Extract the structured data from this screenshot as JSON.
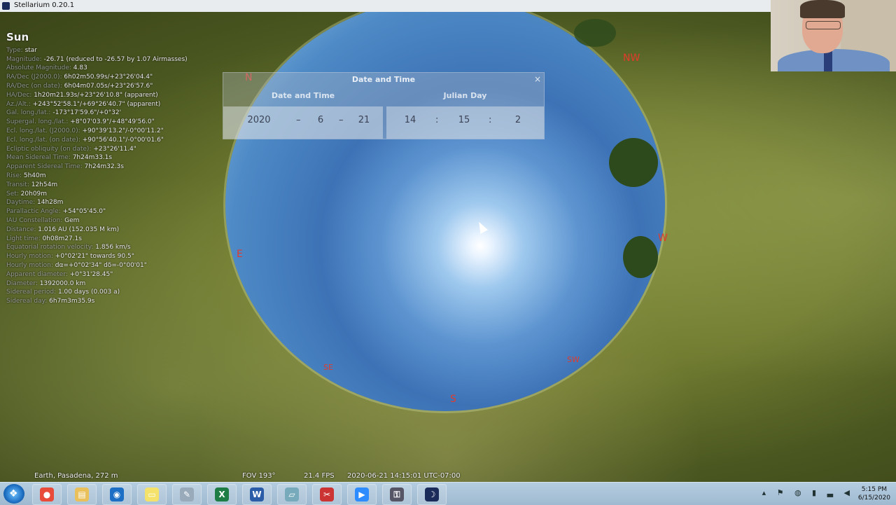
{
  "window": {
    "title": "Stellarium 0.20.1"
  },
  "object_info": {
    "name": "Sun",
    "lines": [
      {
        "label": "Type: ",
        "value": "star"
      },
      {
        "label": "Magnitude: ",
        "value": "-26.71 (reduced to -26.57 by 1.07 Airmasses)"
      },
      {
        "label": "Absolute Magnitude: ",
        "value": "4.83"
      },
      {
        "label": "RA/Dec (J2000.0): ",
        "value": "6h02m50.99s/+23°26'04.4\""
      },
      {
        "label": "RA/Dec (on date): ",
        "value": "6h04m07.05s/+23°26'57.6\""
      },
      {
        "label": "HA/Dec: ",
        "value": "1h20m21.93s/+23°26'10.8\" (apparent)"
      },
      {
        "label": "Az./Alt.: ",
        "value": "+243°52'58.1\"/+69°26'40.7\" (apparent)"
      },
      {
        "label": "Gal. long./lat.: ",
        "value": "-173°17'59.6\"/+0°32'"
      },
      {
        "label": "Supergal. long./lat.: ",
        "value": "+8°07'03.9\"/+48°49'56.0\""
      },
      {
        "label": "Ecl. long./lat. (J2000.0): ",
        "value": "+90°39'13.2\"/-0°00'11.2\""
      },
      {
        "label": "Ecl. long./lat. (on date): ",
        "value": "+90°56'40.1\"/-0°00'01.6\""
      },
      {
        "label": "Ecliptic obliquity (on date): ",
        "value": "+23°26'11.4\""
      },
      {
        "label": "Mean Sidereal Time: ",
        "value": "7h24m33.1s"
      },
      {
        "label": "Apparent Sidereal Time: ",
        "value": "7h24m32.3s"
      },
      {
        "label": "Rise: ",
        "value": "5h40m"
      },
      {
        "label": "Transit: ",
        "value": "12h54m"
      },
      {
        "label": "Set: ",
        "value": "20h09m"
      },
      {
        "label": "Daytime: ",
        "value": "14h28m"
      },
      {
        "label": "Parallactic Angle: ",
        "value": "+54°05'45.0\""
      },
      {
        "label": "IAU Constellation: ",
        "value": "Gem"
      },
      {
        "label": "Distance: ",
        "value": "1.016 AU (152.035 M km)"
      },
      {
        "label": "Light time: ",
        "value": "0h08m27.1s"
      },
      {
        "label": "Equatorial rotation velocity: ",
        "value": "1.856 km/s"
      },
      {
        "label": "Hourly motion: ",
        "value": "+0°02'21\" towards 90.5°"
      },
      {
        "label": "Hourly motion: ",
        "value": "dα=+0°02'34\" dδ=-0°00'01\""
      },
      {
        "label": "Apparent diameter: ",
        "value": "+0°31'28.45\""
      },
      {
        "label": "Diameter: ",
        "value": "1392000.0 km"
      },
      {
        "label": "Sidereal period: ",
        "value": "1.00 days (0.003 a)"
      },
      {
        "label": "Sidereal day: ",
        "value": "6h7m3m35.9s"
      }
    ]
  },
  "cardinals": {
    "n": "N",
    "nw": "NW",
    "w": "W",
    "sw": "SW",
    "s": "S",
    "se": "SE",
    "e": "E"
  },
  "date_dialog": {
    "title": "Date and Time",
    "close": "×",
    "tab_datetime": "Date and Time",
    "tab_julian": "Julian Day",
    "year": "2020",
    "month": "6",
    "day": "21",
    "hour": "14",
    "minute": "15",
    "second": "2",
    "date_sep": "–",
    "time_sep": ":"
  },
  "status": {
    "location": "Earth, Pasadena, 272 m",
    "fov": "FOV 193°",
    "fps": "21.4 FPS",
    "datetime": "2020-06-21 14:15:01 UTC-07:00"
  },
  "taskbar": {
    "items": [
      {
        "name": "chrome",
        "glyph": "●",
        "color": "#e84b3a"
      },
      {
        "name": "file-explorer",
        "glyph": "▤",
        "color": "#e9c05a"
      },
      {
        "name": "outlook",
        "glyph": "◉",
        "color": "#1c6fc4"
      },
      {
        "name": "sticky-notes",
        "glyph": "▭",
        "color": "#f4e26a"
      },
      {
        "name": "paint",
        "glyph": "✎",
        "color": "#9ab"
      },
      {
        "name": "excel",
        "glyph": "X",
        "color": "#1e7d44"
      },
      {
        "name": "word",
        "glyph": "W",
        "color": "#2b5ca8"
      },
      {
        "name": "notepad",
        "glyph": "▱",
        "color": "#7ab"
      },
      {
        "name": "snipping-tool",
        "glyph": "✂",
        "color": "#c33"
      },
      {
        "name": "zoom",
        "glyph": "▶",
        "color": "#2d8cff"
      },
      {
        "name": "security",
        "glyph": "⚿",
        "color": "#556"
      },
      {
        "name": "stellarium",
        "glyph": "☽",
        "color": "#1b2b5a"
      }
    ],
    "clock_time": "5:15 PM",
    "clock_date": "6/15/2020"
  }
}
